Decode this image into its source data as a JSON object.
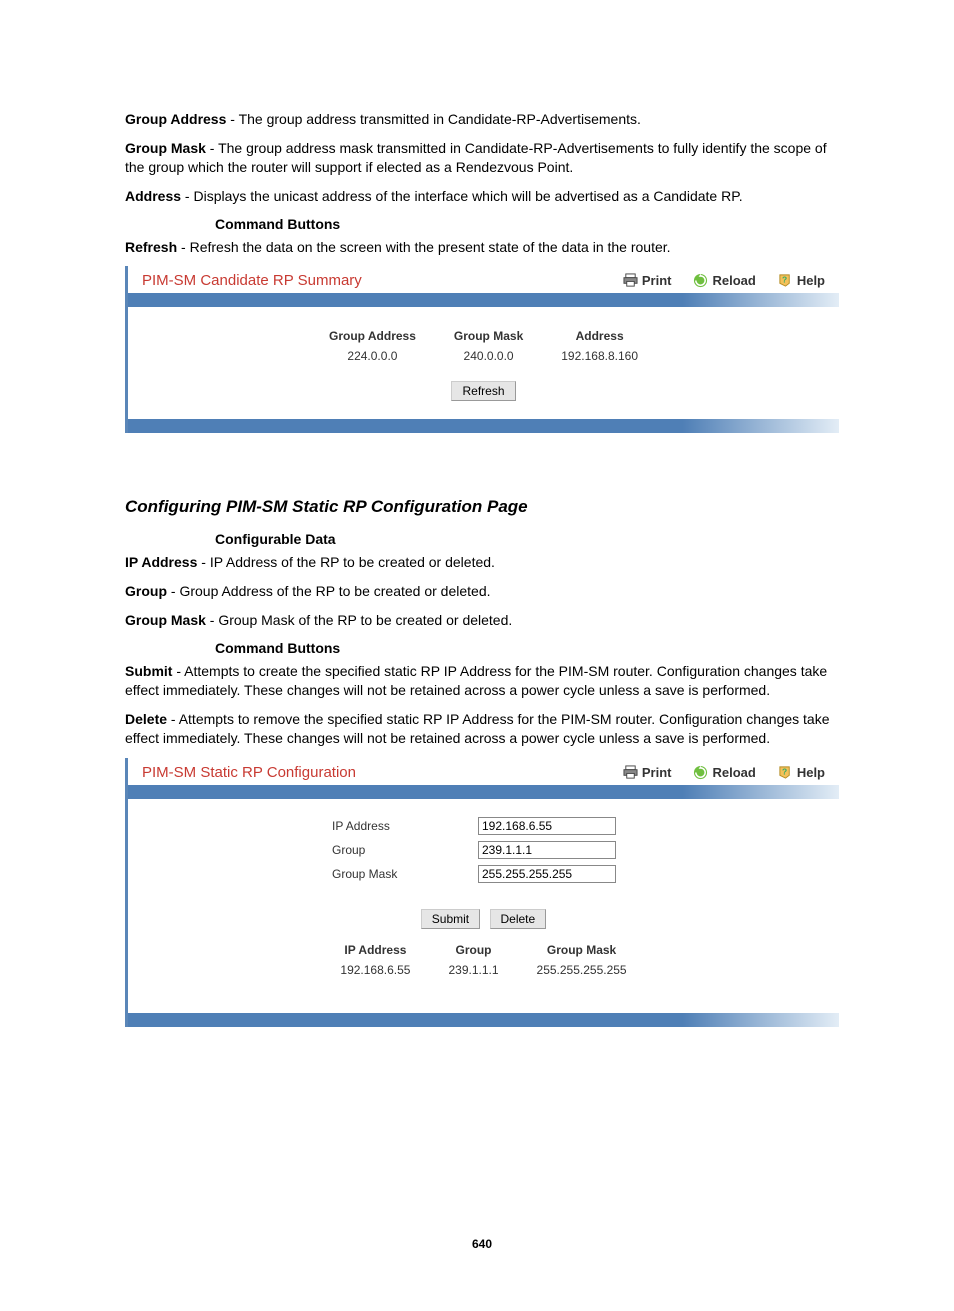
{
  "defs": [
    {
      "term": "Group Address",
      "text": " - The group address transmitted in Candidate-RP-Advertisements."
    },
    {
      "term": "Group Mask",
      "text": " - The group address mask transmitted in Candidate-RP-Advertisements to fully identify the scope of the group which the router will support if elected as a Rendezvous Point."
    },
    {
      "term": "Address",
      "text": " - Displays the unicast address of the interface which will be advertised as a Candidate RP."
    }
  ],
  "sub1": "Command Buttons",
  "refresh_def": {
    "term": "Refresh",
    "text": " - Refresh the data on the screen with the present state of the data in the router."
  },
  "panel1": {
    "title": "PIM-SM Candidate RP Summary",
    "links": {
      "print": "Print",
      "reload": "Reload",
      "help": "Help"
    },
    "headers": [
      "Group Address",
      "Group Mask",
      "Address"
    ],
    "row": [
      "224.0.0.0",
      "240.0.0.0",
      "192.168.8.160"
    ],
    "refresh_btn": "Refresh"
  },
  "section2_title": "Configuring PIM-SM Static RP Configuration Page",
  "sub2a": "Configurable Data",
  "defs2": [
    {
      "term": "IP Address",
      "text": " - IP Address of the RP to be created or deleted."
    },
    {
      "term": "Group",
      "text": " - Group Address of the RP to be created or deleted."
    },
    {
      "term": "Group Mask",
      "text": " - Group Mask of the RP to be created or deleted."
    }
  ],
  "sub2b": "Command Buttons",
  "defs2b": [
    {
      "term": "Submit",
      "text": " - Attempts to create the specified static RP IP Address for the PIM-SM router. Configuration changes take effect immediately. These changes will not be retained across a power cycle unless a save is performed."
    },
    {
      "term": "Delete",
      "text": " - Attempts to remove the specified static RP IP Address for the PIM-SM router. Configuration changes take effect immediately. These changes will not be retained across a power cycle unless a save is performed."
    }
  ],
  "panel2": {
    "title": "PIM-SM Static RP Configuration",
    "links": {
      "print": "Print",
      "reload": "Reload",
      "help": "Help"
    },
    "fields": {
      "ip_label": "IP Address",
      "ip_value": "192.168.6.55",
      "group_label": "Group",
      "group_value": "239.1.1.1",
      "mask_label": "Group Mask",
      "mask_value": "255.255.255.255"
    },
    "submit_btn": "Submit",
    "delete_btn": "Delete",
    "headers": [
      "IP Address",
      "Group",
      "Group Mask"
    ],
    "row": [
      "192.168.6.55",
      "239.1.1.1",
      "255.255.255.255"
    ]
  },
  "page_number": "640"
}
